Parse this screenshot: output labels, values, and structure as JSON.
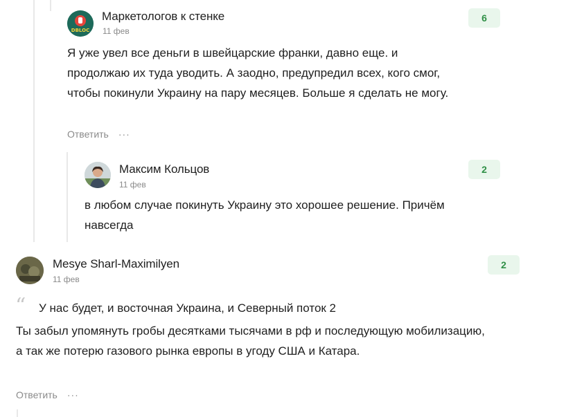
{
  "comments": [
    {
      "author": "Маркетологов к стенке",
      "date": "11 фев",
      "likes": "6",
      "avatar_label": "DBLOC",
      "text": "Я уже увел все деньги в швейцарские франки, давно еще. и продолжаю их туда уводить. А заодно, предупредил всех, кого смог, чтобы покинули Украину на пару месяцев. Больше я сделать не могу.",
      "reply_label": "Ответить",
      "more_label": "···"
    },
    {
      "author": "Максим Кольцов",
      "date": "11 фев",
      "likes": "2",
      "text": "в любом случае покинуть Украину это хорошее решение. Причём навсегда"
    },
    {
      "author": "Mesye Sharl-Maximilyen",
      "date": "11 фев",
      "likes": "2",
      "quote": "У нас будет, и восточная Украина, и Северный поток 2",
      "text": "Ты забыл упомянуть гробы десятками тысячами в рф и последующую мобилизацию, а так же потерю газового рынка европы в угоду США и Катара.",
      "reply_label": "Ответить",
      "more_label": "···"
    }
  ],
  "colors": {
    "likes_bg": "#e9f6ec",
    "likes_text": "#2f8f46",
    "muted": "#8a8a8a"
  }
}
